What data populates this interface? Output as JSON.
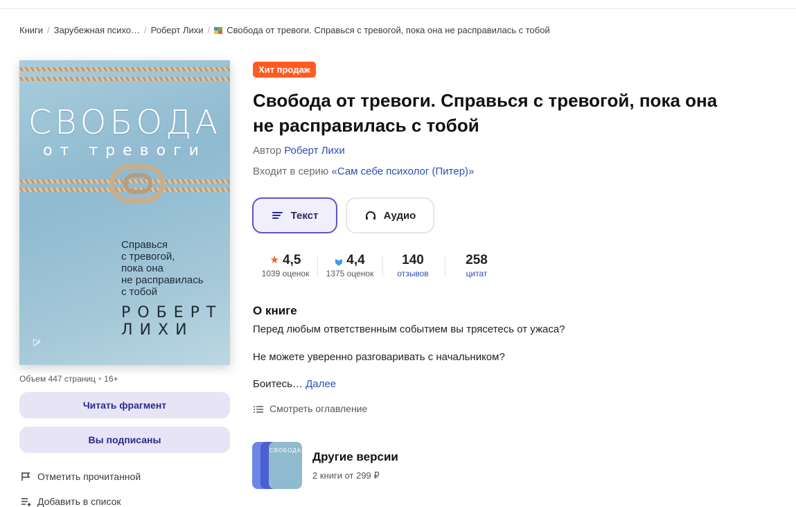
{
  "breadcrumb": {
    "items": [
      "Книги",
      "Зарубежная психо…",
      "Роберт Лихи"
    ],
    "current": "Свобода от тревоги. Справься с тревогой, пока она не расправилась с тобой",
    "separator": "/"
  },
  "cover": {
    "title_big": "СВОБОДА",
    "title_small": "от тревоги",
    "tagline": [
      "Справься",
      "с тревогой,",
      "пока она",
      "не расправилась",
      "с тобой"
    ],
    "author": [
      "РОБЕРТ",
      "ЛИХИ"
    ],
    "publisher_mark": "▷̷"
  },
  "details": {
    "volume": "Объем 447 страниц",
    "age": "16+"
  },
  "side_buttons": {
    "read_fragment": "Читать фрагмент",
    "subscribed": "Вы подписаны"
  },
  "side_actions": {
    "mark_read": "Отметить прочитанной",
    "add_to_list": "Добавить в список"
  },
  "badge": "Хит продаж",
  "title": "Свобода от тревоги. Справься с тревогой, пока она не расправилась с тобой",
  "author": {
    "label": "Автор",
    "name": "Роберт Лихи"
  },
  "series": {
    "label": "Входит в серию",
    "name": "«Сам себе психолог (Питер)»"
  },
  "formats": {
    "text": "Текст",
    "audio": "Аудио"
  },
  "stats": {
    "rating_litres": {
      "value": "4,5",
      "label": "1039 оценок"
    },
    "rating_other": {
      "value": "4,4",
      "label": "1375 оценок"
    },
    "reviews": {
      "value": "140",
      "label": "отзывов"
    },
    "quotes": {
      "value": "258",
      "label": "цитат"
    }
  },
  "about": {
    "heading": "О книге",
    "p1": "Перед любым ответственным событием вы трясетесь от ужаса?",
    "p2": "Не можете уверенно разговаривать с начальником?",
    "p3": "Боитесь…",
    "more": "Далее",
    "toc": "Смотреть оглавление"
  },
  "versions": {
    "title": "Другие версии",
    "subtitle": "2 книги от 299 ₽",
    "thumb_text": "СВОБОДА"
  },
  "colors": {
    "accent": "#5b55c7",
    "badge": "#ff5a1f",
    "link": "#2b4fb0",
    "star": "#ff5a1f",
    "shield": "#3aa0e8"
  }
}
